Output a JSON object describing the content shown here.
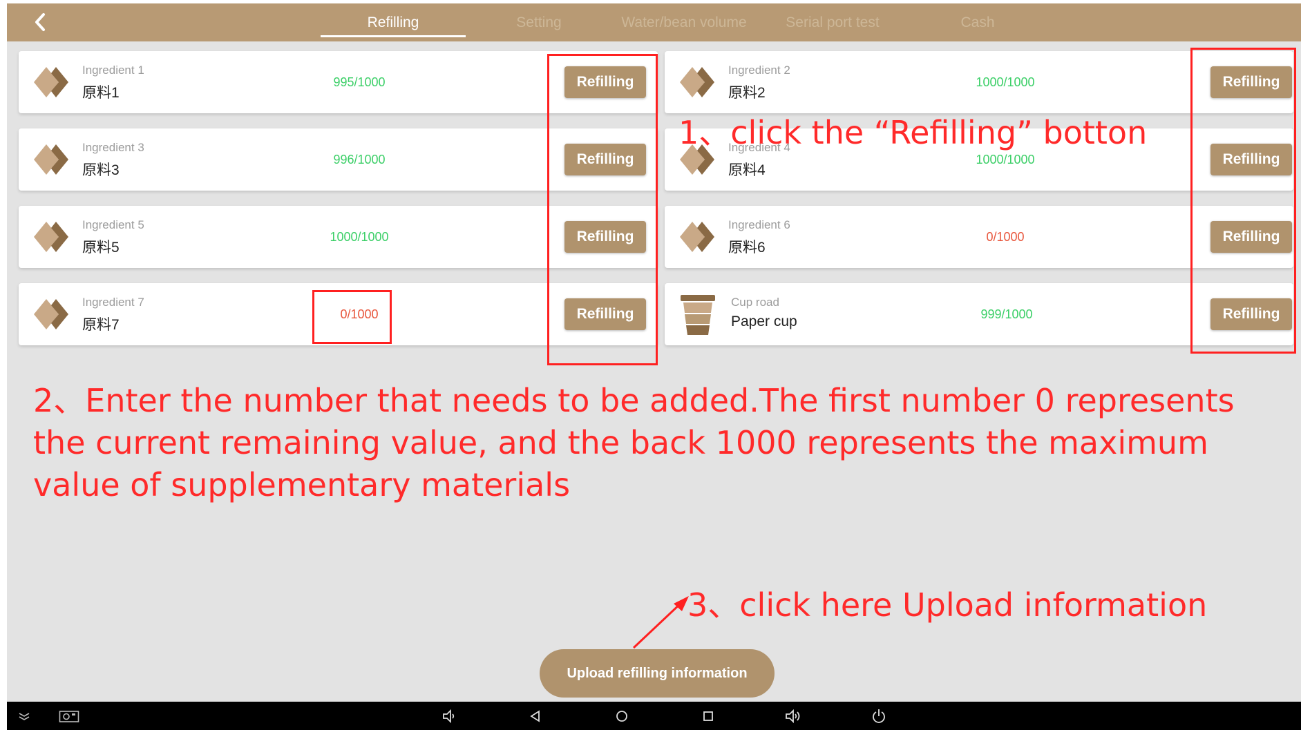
{
  "tabs": [
    {
      "label": "Refilling",
      "active": true
    },
    {
      "label": "Setting",
      "active": false
    },
    {
      "label": "Water/bean volume",
      "active": false
    },
    {
      "label": "Serial port test",
      "active": false
    },
    {
      "label": "Cash",
      "active": false
    }
  ],
  "ingredients": [
    {
      "name_en": "Ingredient 1",
      "name_cn": "原料1",
      "level": "995/1000",
      "status": "ok",
      "button": "Refilling"
    },
    {
      "name_en": "Ingredient 2",
      "name_cn": "原料2",
      "level": "1000/1000",
      "status": "ok",
      "button": "Refilling"
    },
    {
      "name_en": "Ingredient 3",
      "name_cn": "原料3",
      "level": "996/1000",
      "status": "ok",
      "button": "Refilling"
    },
    {
      "name_en": "Ingredient 4",
      "name_cn": "原料4",
      "level": "1000/1000",
      "status": "ok",
      "button": "Refilling"
    },
    {
      "name_en": "Ingredient 5",
      "name_cn": "原料5",
      "level": "1000/1000",
      "status": "ok",
      "button": "Refilling"
    },
    {
      "name_en": "Ingredient 6",
      "name_cn": "原料6",
      "level": "0/1000",
      "status": "empty",
      "button": "Refilling"
    },
    {
      "name_en": "Ingredient 7",
      "name_cn": "原料7",
      "level": "0/1000",
      "status": "empty",
      "button": "Refilling"
    },
    {
      "name_en": "Cup road",
      "name_cn": "Paper cup",
      "level": "999/1000",
      "status": "ok",
      "button": "Refilling"
    }
  ],
  "annotations": {
    "step1": "1、click the “Refilling” botton",
    "step2": "2、Enter the number that needs to be added.The first number 0 represents the current remaining value, and the back 1000 represents the maximum value of supplementary materials",
    "step3": "3、click here Upload information"
  },
  "upload_button": "Upload refilling information",
  "colors": {
    "topbar": "#b89a74",
    "button": "#b0936d",
    "level_ok": "#3bcf67",
    "level_empty": "#e8553b",
    "annotation": "#ff2a2a"
  },
  "icons": {
    "back": "chevron-left-icon",
    "ingredient": "diamond-icon",
    "cup": "paper-cup-icon",
    "nav": [
      "collapse-icon",
      "screenshot-icon",
      "volume-down-icon",
      "nav-back-icon",
      "home-icon",
      "recents-icon",
      "volume-up-icon",
      "power-icon"
    ]
  }
}
